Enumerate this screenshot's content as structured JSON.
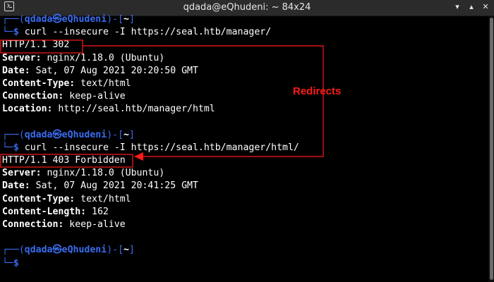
{
  "window": {
    "title": "qdada@eQhudeni: ~ 84x24",
    "icon": "terminal-icon",
    "controls": [
      "minimize-icon",
      "maximize-icon",
      "close-icon"
    ]
  },
  "prompt": {
    "user": "qdada",
    "at": "㉿",
    "host": "eQhudeni",
    "dir": "~",
    "open": "┌──(",
    "mid": ")-[",
    "close": "]",
    "corner": "└─",
    "symbol": "$"
  },
  "commands": [
    {
      "cmd": "curl --insecure -I https://seal.htb/manager/",
      "status": "HTTP/1.1 302",
      "headers": [
        {
          "key": "Server:",
          "value": " nginx/1.18.0 (Ubuntu)"
        },
        {
          "key": "Date:",
          "value": " Sat, 07 Aug 2021 20:20:50 GMT"
        },
        {
          "key": "Content-Type:",
          "value": " text/html"
        },
        {
          "key": "Connection:",
          "value": " keep-alive"
        },
        {
          "key": "Location:",
          "value": " http://seal.htb/manager/html"
        }
      ]
    },
    {
      "cmd": "curl --insecure -I https://seal.htb/manager/html/",
      "status": "HTTP/1.1 403 Forbidden",
      "headers": [
        {
          "key": "Server:",
          "value": " nginx/1.18.0 (Ubuntu)"
        },
        {
          "key": "Date:",
          "value": " Sat, 07 Aug 2021 20:41:25 GMT"
        },
        {
          "key": "Content-Type:",
          "value": " text/html"
        },
        {
          "key": "Content-Length:",
          "value": " 162"
        },
        {
          "key": "Connection:",
          "value": " keep-alive"
        }
      ]
    }
  ],
  "annotation": {
    "label": "Redirects",
    "color": "#ff1a1a"
  },
  "colors": {
    "background": "#000000",
    "prompt_blue": "#3a6cf0",
    "prompt_green": "#2ad92a",
    "text": "#ffffff"
  }
}
